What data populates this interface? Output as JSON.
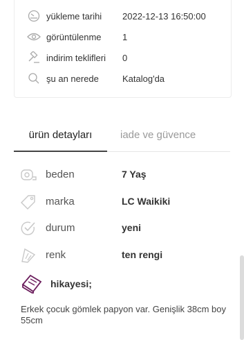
{
  "meta": [
    {
      "icon": "speedometer-icon",
      "label": "yükleme tarihi",
      "value": "2022-12-13 16:50:00"
    },
    {
      "icon": "eye-icon",
      "label": "görüntülenme",
      "value": "1"
    },
    {
      "icon": "gavel-icon",
      "label": "indirim teklifleri",
      "value": "0"
    },
    {
      "icon": "search-icon",
      "label": "şu an nerede",
      "value": "Katalog'da"
    }
  ],
  "tabs": {
    "details": "ürün detayları",
    "guarantee": "iade ve güvence"
  },
  "details": [
    {
      "icon": "tape-measure-icon",
      "label": "beden",
      "value": "7 Yaş"
    },
    {
      "icon": "tag-icon",
      "label": "marka",
      "value": "LC Waikiki"
    },
    {
      "icon": "checkmark-icon",
      "label": "durum",
      "value": "yeni"
    },
    {
      "icon": "color-swatch-icon",
      "label": "renk",
      "value": "ten rengi"
    }
  ],
  "story": {
    "icon": "book-icon",
    "title": "hikayesi;",
    "text": "Erkek çocuk gömlek papyon var. Genişlik 38cm boy 55cm"
  },
  "colors": {
    "accent": "#6b1d5c",
    "icon_gray": "#c8c8c8"
  }
}
